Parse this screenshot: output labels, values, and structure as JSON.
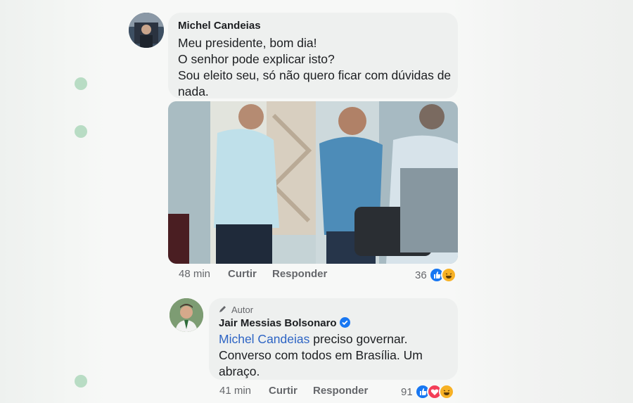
{
  "comment1": {
    "author": "Michel Candeias",
    "lines": [
      "Meu presidente, bom dia!",
      "O senhor pode explicar isto?",
      "Sou eleito seu, só não quero ficar com dúvidas de",
      "nada."
    ],
    "time": "48 min",
    "like_label": "Curtir",
    "reply_label": "Responder",
    "reaction_count": "36",
    "reaction_icons": [
      "like-icon",
      "haha-icon"
    ]
  },
  "comment2": {
    "badge_label": "Autor",
    "author": "Jair Messias Bolsonaro",
    "mention": "Michel Candeias",
    "text_after_mention": " preciso governar.",
    "lines": [
      "Converso com todos em Brasília. Um",
      "abraço."
    ],
    "time": "41 min",
    "like_label": "Curtir",
    "reply_label": "Responder",
    "reaction_count": "91",
    "reaction_icons": [
      "like-icon",
      "love-icon",
      "haha-icon"
    ]
  },
  "colors": {
    "bubble": "#eef0ef",
    "mention": "#2d64c4",
    "like": "#1877f2",
    "love": "#f33e58",
    "haha": "#f7b125"
  }
}
